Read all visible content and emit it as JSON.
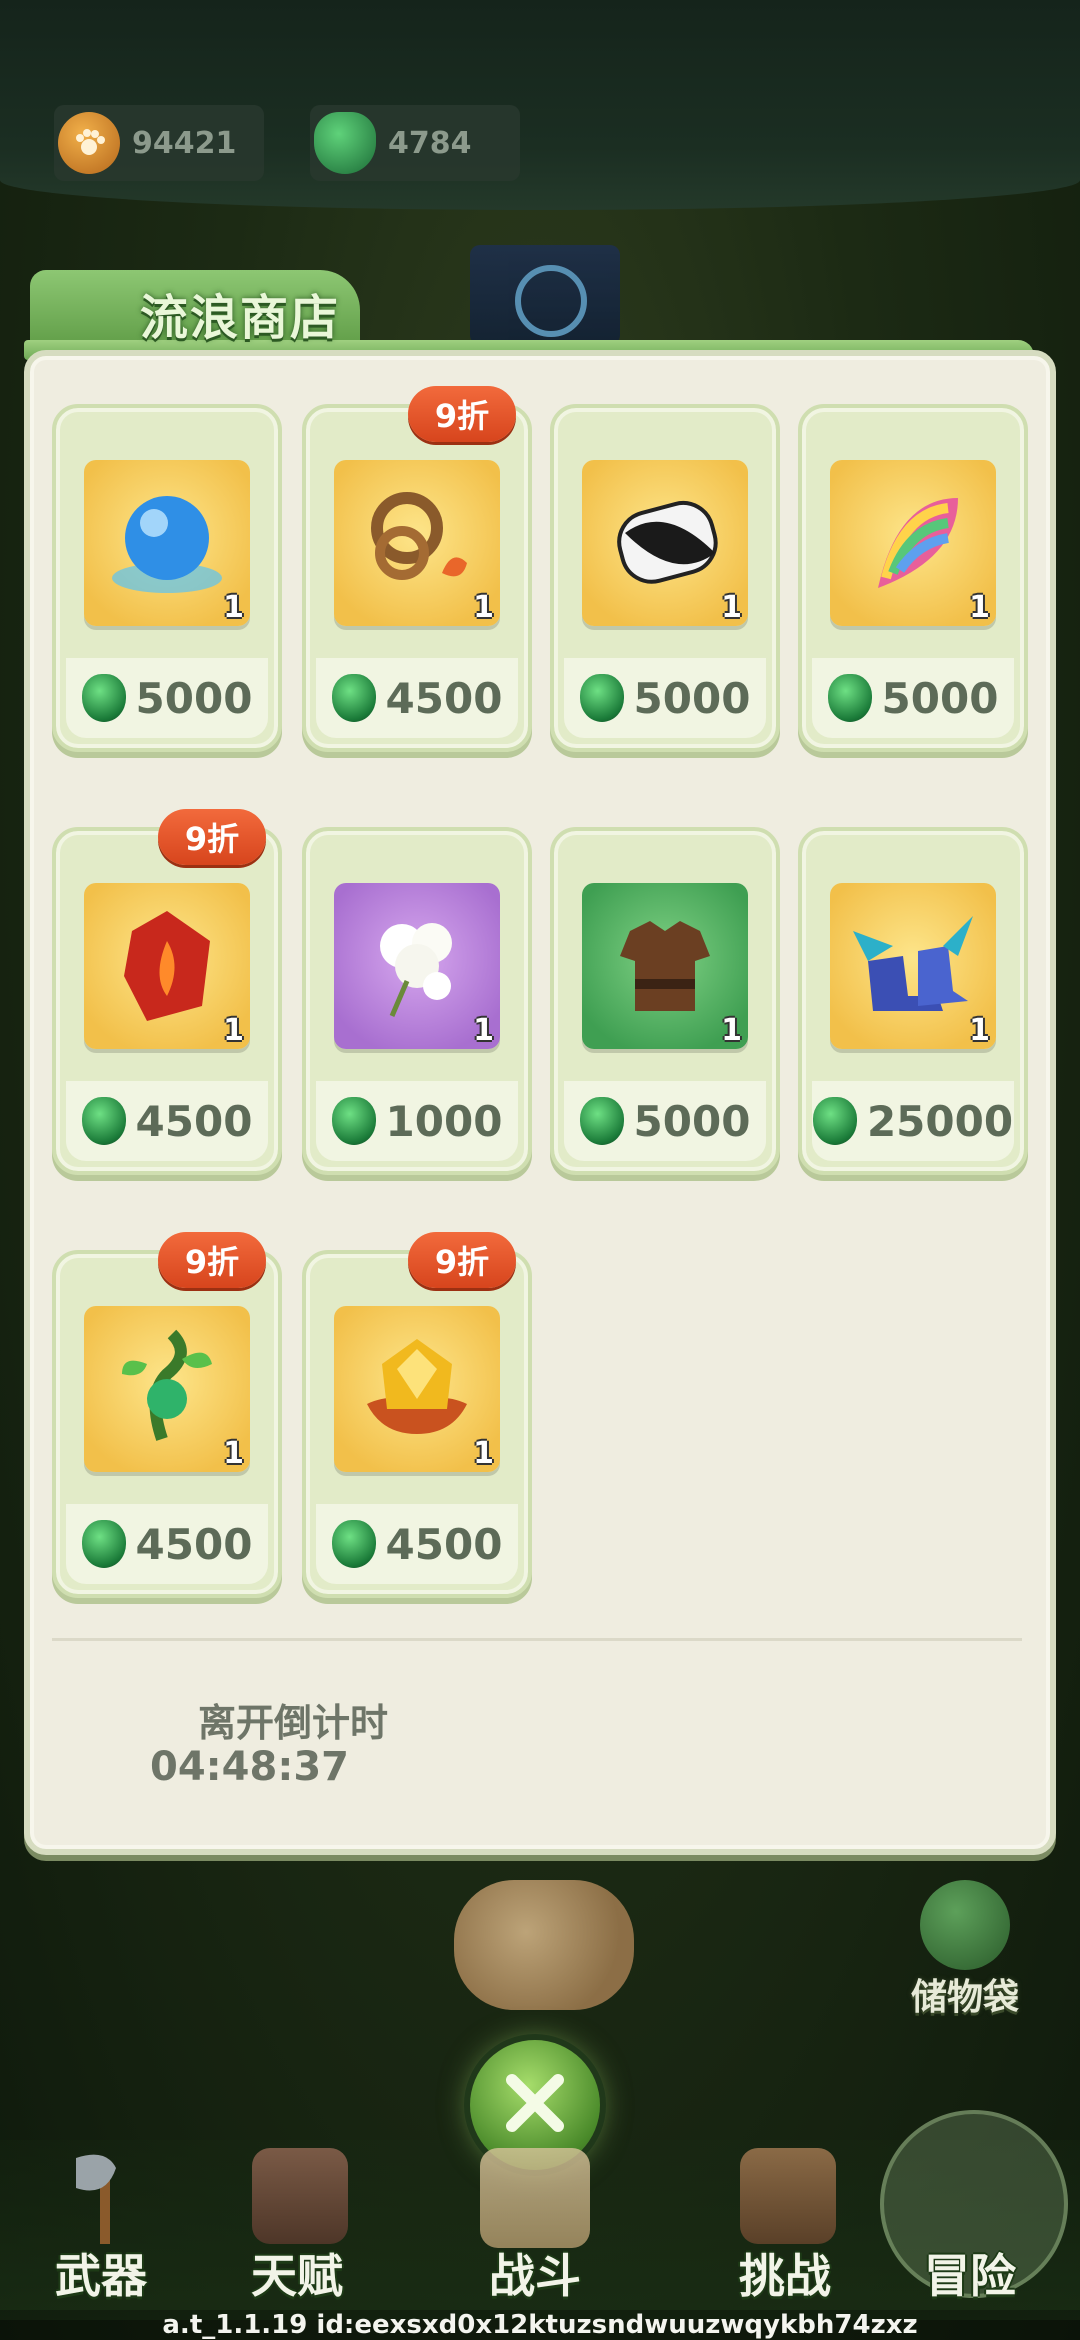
{
  "resources": {
    "paw_amount": "94421",
    "gem_amount": "4784"
  },
  "shop": {
    "title": "流浪商店",
    "items": [
      {
        "price": "5000",
        "qty": "1",
        "discount": null,
        "bg": "yellow",
        "icon": "water-orb-icon"
      },
      {
        "price": "4500",
        "qty": "1",
        "discount": "9折",
        "bg": "yellow",
        "icon": "fire-rope-icon"
      },
      {
        "price": "5000",
        "qty": "1",
        "discount": null,
        "bg": "yellow",
        "icon": "yin-yang-scroll-icon"
      },
      {
        "price": "5000",
        "qty": "1",
        "discount": null,
        "bg": "yellow",
        "icon": "rainbow-wing-icon"
      },
      {
        "price": "4500",
        "qty": "1",
        "discount": "9折",
        "bg": "yellow",
        "icon": "fire-crystal-icon"
      },
      {
        "price": "1000",
        "qty": "1",
        "discount": null,
        "bg": "purple",
        "icon": "cotton-icon"
      },
      {
        "price": "5000",
        "qty": "1",
        "discount": null,
        "bg": "green",
        "icon": "leather-armor-icon"
      },
      {
        "price": "25000",
        "qty": "1",
        "discount": null,
        "bg": "yellow",
        "icon": "winged-boots-icon"
      },
      {
        "price": "4500",
        "qty": "1",
        "discount": "9折",
        "bg": "yellow",
        "icon": "sapling-icon"
      },
      {
        "price": "4500",
        "qty": "1",
        "discount": "9折",
        "bg": "yellow",
        "icon": "amber-crystal-icon"
      }
    ],
    "countdown_label": "离开倒计时",
    "countdown_time": "04:48:37"
  },
  "bag": {
    "label": "储物袋"
  },
  "nav": {
    "weapon": "武器",
    "talent": "天赋",
    "battle": "战斗",
    "challenge": "挑战",
    "adventure": "冒险"
  },
  "build_info": "a.t_1.1.19 id:eexsxd0x12ktuzsndwuuzwqykbh74zxz"
}
